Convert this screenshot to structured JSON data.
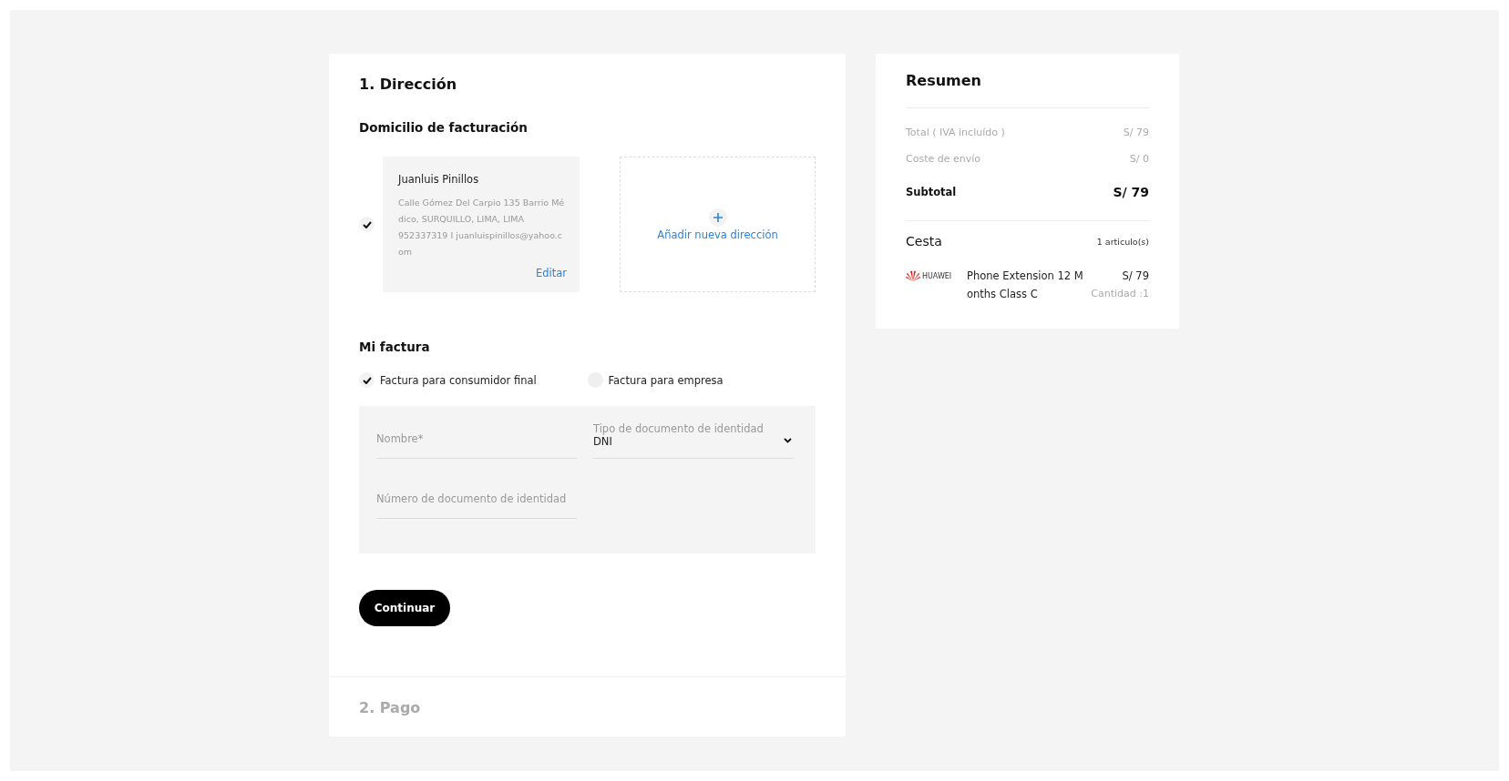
{
  "steps": [
    {
      "title": "1. Dirección",
      "active": true
    },
    {
      "title": "2. Pago",
      "active": false
    }
  ],
  "billing_address": {
    "heading": "Domicilio de facturación",
    "addresses": [
      {
        "name": "Juanluis Pinillos",
        "address": "Calle Gómez Del Carpio 135 Barrio Médico, SURQUILLO, LIMA, LIMA",
        "contact": "952337319 I juanluispinillos@yahoo.com",
        "edit": "Editar",
        "selected": true
      }
    ],
    "add_new": "Añadir nueva dirección"
  },
  "invoice": {
    "heading": "Mi factura",
    "options": [
      {
        "label": "Factura para consumidor final",
        "selected": true
      },
      {
        "label": "Factura para empresa",
        "selected": false
      }
    ],
    "fields": [
      {
        "kind": "text",
        "placeholder": "Nombre*"
      },
      {
        "kind": "select",
        "label": "Tipo de documento de identidad",
        "value": "DNI"
      },
      {
        "kind": "text",
        "placeholder": "Número de documento de identidad"
      }
    ]
  },
  "continue_button": "Continuar",
  "summary": {
    "title": "Resumen",
    "rows": [
      {
        "label": "Total ( IVA incluído )",
        "value": "S/ 79",
        "kind": "muted"
      },
      {
        "label": "Coste de envío",
        "value": "S/ 0",
        "kind": "muted"
      },
      {
        "label": "Subtotal",
        "value": "S/ 79",
        "kind": "strong"
      }
    ],
    "basket": {
      "title": "Cesta",
      "count": "1 articulo(s)",
      "items": [
        {
          "brand": "HUAWEI",
          "name": "Phone Extension 12 Months Class C",
          "price": "S/ 79",
          "quantity": "Cantidad :1"
        }
      ]
    }
  }
}
